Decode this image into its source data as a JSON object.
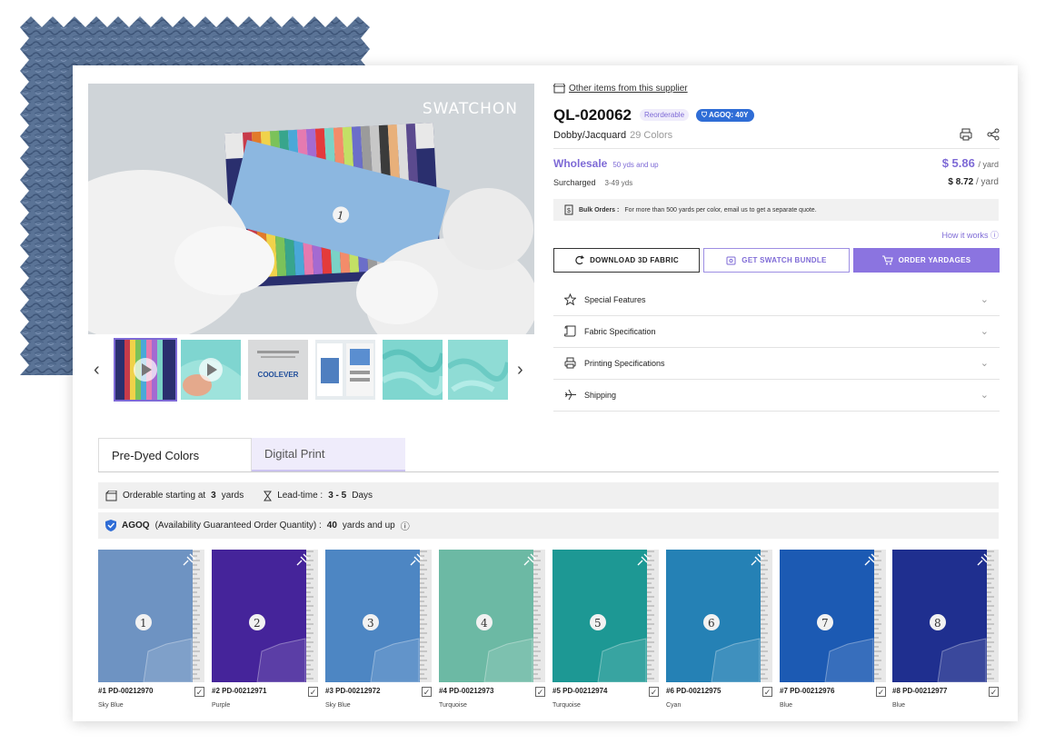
{
  "brand_watermark": "SWATCHON",
  "supplier_link": "Other items from this supplier",
  "product": {
    "code": "QL-020062",
    "badge_reorderable": "Reorderable",
    "badge_agoq": "AGOQ: 40Y",
    "type": "Dobby/Jacquard",
    "colors": "29 Colors"
  },
  "pricing": {
    "wholesale_label": "Wholesale",
    "wholesale_range": "50 yds and up",
    "wholesale_price": "$ 5.86",
    "unit": "/ yard",
    "surcharged_label": "Surcharged",
    "surcharged_range": "3-49 yds",
    "surcharged_price": "$ 8.72"
  },
  "bulk": {
    "label": "Bulk Orders :",
    "text": "For more than 500 yards per color, email us to get a separate quote."
  },
  "how_it_works": "How it works",
  "buttons": {
    "download": "DOWNLOAD 3D FABRIC",
    "swatch": "GET SWATCH BUNDLE",
    "order": "ORDER YARDAGES"
  },
  "accordion": [
    {
      "label": "Special Features",
      "icon": "star-icon"
    },
    {
      "label": "Fabric Specification",
      "icon": "scroll-icon"
    },
    {
      "label": "Printing Specifications",
      "icon": "printer-icon"
    },
    {
      "label": "Shipping",
      "icon": "airplane-icon"
    }
  ],
  "thumbnail_texts": {
    "coolever": "COOLEVER"
  },
  "tabs": {
    "predyed": "Pre-Dyed Colors",
    "digital": "Digital Print"
  },
  "orderable": {
    "prefix": "Orderable starting at",
    "yards": "3",
    "yards_unit": "yards",
    "lead_label": "Lead-time :",
    "lead_value": "3 - 5",
    "lead_unit": "Days"
  },
  "agoq_row": {
    "label": "AGOQ",
    "desc": "(Availability Guaranteed Order Quantity) :",
    "value": "40",
    "unit": "yards and up"
  },
  "swatches": [
    {
      "num": "1",
      "code": "#1 PD-00212970",
      "name": "Sky Blue",
      "color": "#6e93c2"
    },
    {
      "num": "2",
      "code": "#2 PD-00212971",
      "name": "Purple",
      "color": "#45249a"
    },
    {
      "num": "3",
      "code": "#3 PD-00212972",
      "name": "Sky Blue",
      "color": "#4d86c3"
    },
    {
      "num": "4",
      "code": "#4 PD-00212973",
      "name": "Turquoise",
      "color": "#6cb9a4"
    },
    {
      "num": "5",
      "code": "#5 PD-00212974",
      "name": "Turquoise",
      "color": "#1d9894"
    },
    {
      "num": "6",
      "code": "#6 PD-00212975",
      "name": "Cyan",
      "color": "#2581b5"
    },
    {
      "num": "7",
      "code": "#7 PD-00212976",
      "name": "Blue",
      "color": "#1c5ab3"
    },
    {
      "num": "8",
      "code": "#8 PD-00212977",
      "name": "Blue",
      "color": "#1f2f8f"
    }
  ]
}
